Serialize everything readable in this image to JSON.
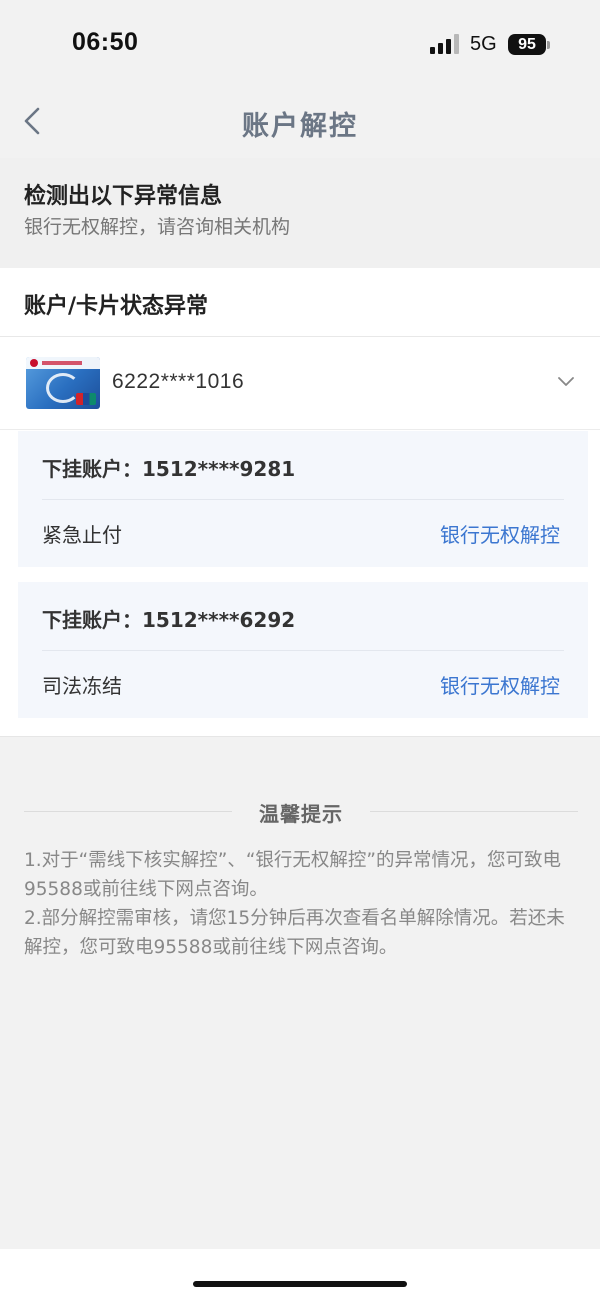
{
  "status_bar": {
    "time": "06:50",
    "network": "5G",
    "battery": "95"
  },
  "nav": {
    "title": "账户解控"
  },
  "alert": {
    "title": "检测出以下异常信息",
    "subtitle": "银行无权解控，请咨询相关机构"
  },
  "status_section": {
    "heading": "账户/卡片状态异常"
  },
  "card": {
    "number": "6222****1016",
    "sub_accounts": [
      {
        "account": "下挂账户：1512****9281",
        "status": "紧急止付",
        "action": "银行无权解控"
      },
      {
        "account": "下挂账户：1512****6292",
        "status": "司法冻结",
        "action": "银行无权解控"
      }
    ]
  },
  "tips": {
    "title": "温馨提示",
    "items": [
      "1.对于“需线下核实解控”、“银行无权解控”的异常情况，您可致电95588或前往线下网点咨询。",
      "2.部分解控需审核，请您15分钟后再次查看名单解除情况。若还未解控，您可致电95588或前往线下网点咨询。"
    ]
  }
}
